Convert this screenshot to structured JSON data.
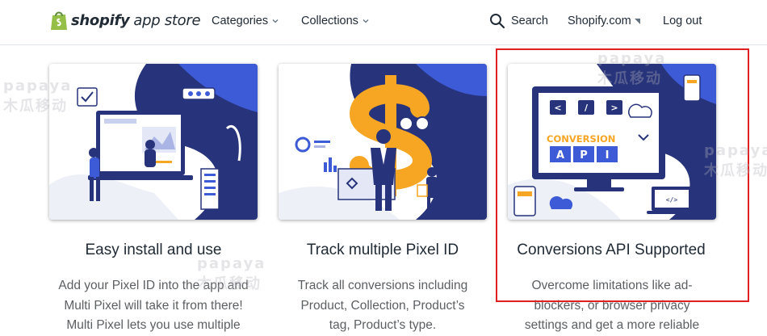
{
  "header": {
    "logo_brand": "shopify",
    "logo_suffix": "app store",
    "nav": {
      "categories": "Categories",
      "collections": "Collections",
      "search": "Search",
      "shopify_com": "Shopify.com",
      "logout": "Log out"
    }
  },
  "features": [
    {
      "title": "Easy install and use",
      "lines": [
        "Add your Pixel ID into the app and",
        "Multi Pixel will take it from there!",
        "Multi Pixel lets you use multiple"
      ]
    },
    {
      "title": "Track multiple Pixel ID",
      "lines": [
        "Track all conversions including",
        "Product, Collection, Product’s",
        "tag, Product’s type."
      ]
    },
    {
      "title": "Conversions API Supported",
      "lines": [
        "Overcome limitations like ad-",
        "blockers, or browser privacy",
        "settings and get a more reliable"
      ]
    }
  ],
  "illustration3": {
    "code_left": "<",
    "code_mid": "/",
    "code_right": ">",
    "word1": "CONVERSION",
    "api_letters": [
      "A",
      "P",
      "I"
    ],
    "laptop_code": "</>"
  },
  "watermark": {
    "latin": "papaya",
    "cjk": "木瓜移动"
  },
  "colors": {
    "navy": "#27337a",
    "blue": "#3d5bd6",
    "orange": "#f6a623",
    "highlight": "#e02020"
  }
}
